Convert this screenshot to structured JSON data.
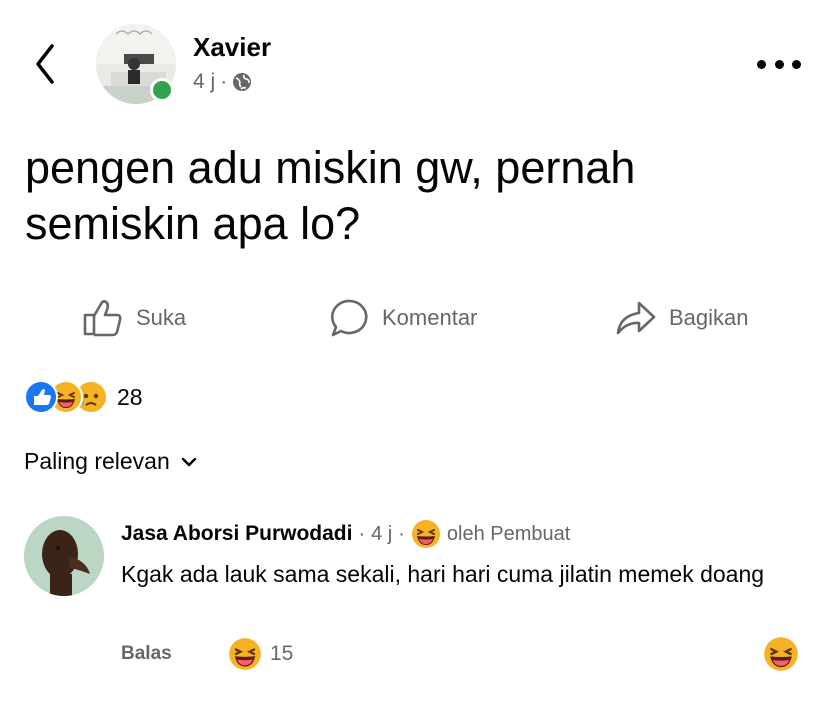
{
  "header": {
    "author_name": "Xavier",
    "time": "4 j",
    "separator": "·",
    "privacy_icon": "globe-icon",
    "online_color": "#31a24c"
  },
  "post": {
    "text": "pengen adu miskin gw, pernah semiskin apa lo?"
  },
  "actions": {
    "like_label": "Suka",
    "comment_label": "Komentar",
    "share_label": "Bagikan"
  },
  "reactions": {
    "icons": [
      "like-reaction-icon",
      "haha-reaction-icon",
      "sad-reaction-icon"
    ],
    "count": "28",
    "like_color": "#1877f2"
  },
  "sort": {
    "label": "Paling relevan"
  },
  "comment": {
    "author": "Jasa Aborsi Purwodadi",
    "separator": "·",
    "time": "4 j",
    "separator2": "·",
    "reacted_by": "oleh Pembuat",
    "text": "Kgak ada lauk sama sekali, hari hari cuma jilatin memek doang",
    "reply_label": "Balas",
    "reaction_count": "15"
  }
}
